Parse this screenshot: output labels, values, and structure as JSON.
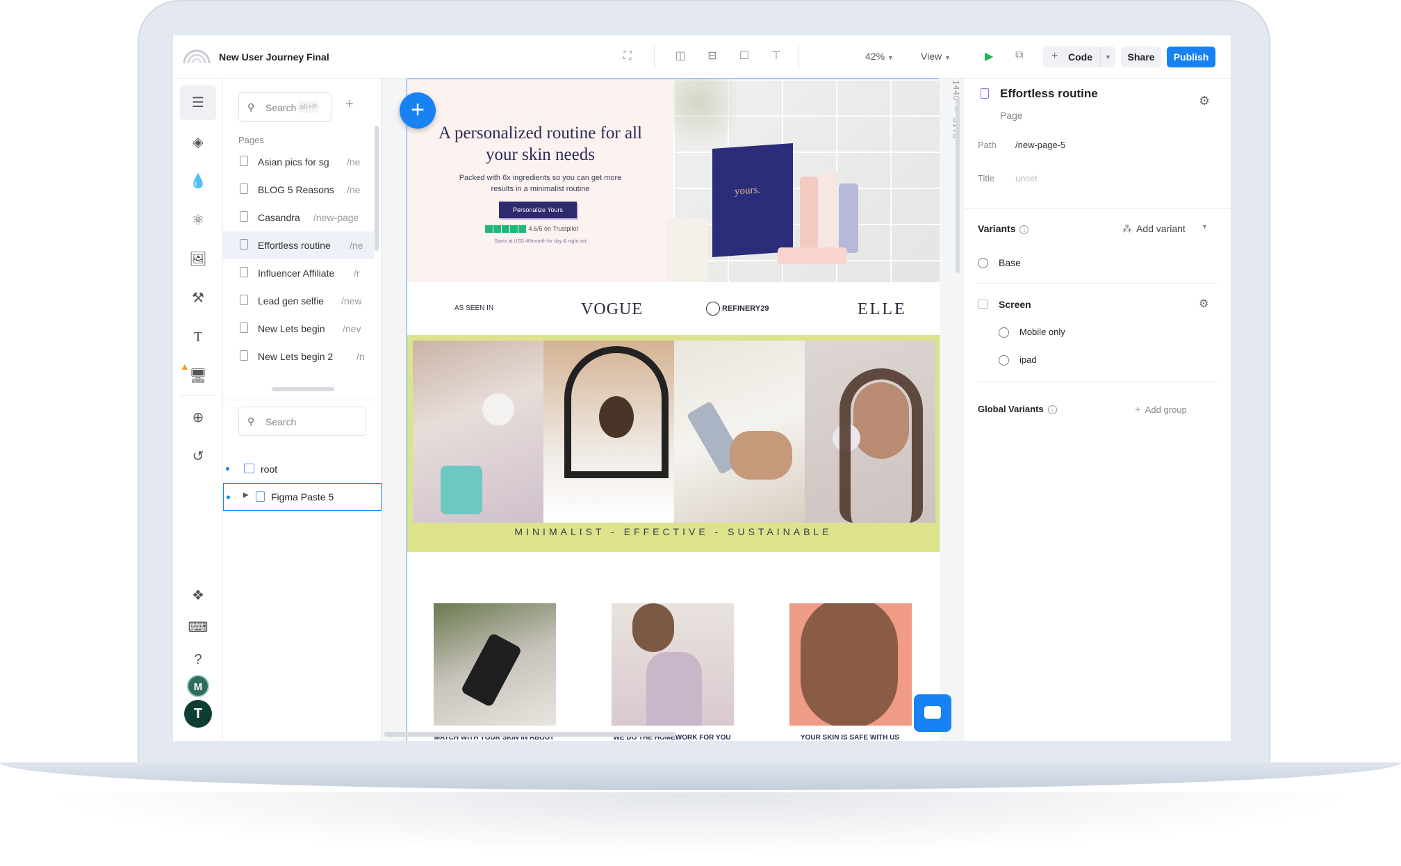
{
  "app": {
    "doc_title": "New User Journey Final",
    "zoom": "42%",
    "view_label": "View",
    "code_label": "Code",
    "share_label": "Share",
    "publish_label": "Publish"
  },
  "colors": {
    "accent": "#1682f4",
    "play": "#1fb34c",
    "hero_bg": "#fcf2ef",
    "yellow_band": "#dde38c",
    "navy": "#2e2a6e"
  },
  "left_panel": {
    "search_placeholder": "Search",
    "search_shortcut": "alt+P",
    "pages_label": "Pages",
    "pages": [
      {
        "name": "Asian pics for sg",
        "path": "/ne"
      },
      {
        "name": "BLOG 5 Reasons",
        "path": "/ne"
      },
      {
        "name": "Casandra",
        "path": "/new-page"
      },
      {
        "name": "Effortless routine",
        "path": "/ne"
      },
      {
        "name": "Influencer Affiliate",
        "path": "/r"
      },
      {
        "name": "Lead gen selfie",
        "path": "/new"
      },
      {
        "name": "New Lets begin",
        "path": "/nev"
      },
      {
        "name": "New Lets begin 2",
        "path": "/n"
      }
    ],
    "tree_search_placeholder": "Search",
    "tree": [
      {
        "label": "root"
      },
      {
        "label": "Figma Paste 5"
      }
    ]
  },
  "rail": {
    "avatars": [
      "M",
      "T"
    ]
  },
  "canvas": {
    "dimensions": "1440 × 5173",
    "hero_heading": "A personalized routine for all your skin needs",
    "hero_text": "Packed with 6x ingredients so you can get more results in a minimalist routine",
    "hero_button": "Personalize Yours",
    "trustpilot": "4.6/5 on Trustpilot",
    "hero_small": "Starts at USD 40/month for day & night set",
    "box_brand": "yours.",
    "press": {
      "as_seen_in": "AS SEEN IN",
      "vogue": "VOGUE",
      "refinery": "REFINERY29",
      "elle": "ELLE"
    },
    "tagline": "MINIMALIST   -   EFFECTIVE   -   SUSTAINABLE",
    "card_captions": [
      "MATCH WITH YOUR SKIN IN ABOUT",
      "WE DO THE HOMEWORK FOR YOU",
      "YOUR SKIN IS SAFE WITH US"
    ]
  },
  "right_panel": {
    "page_title": "Effortless routine",
    "page_type": "Page",
    "path_label": "Path",
    "path_value": "/new-page-5",
    "title_label": "Title",
    "title_value": "unset",
    "variants_label": "Variants",
    "add_variant": "Add variant",
    "base_label": "Base",
    "screen_label": "Screen",
    "screen_variants": [
      "Mobile only",
      "ipad"
    ],
    "global_variants_label": "Global Variants",
    "add_group": "Add group"
  }
}
